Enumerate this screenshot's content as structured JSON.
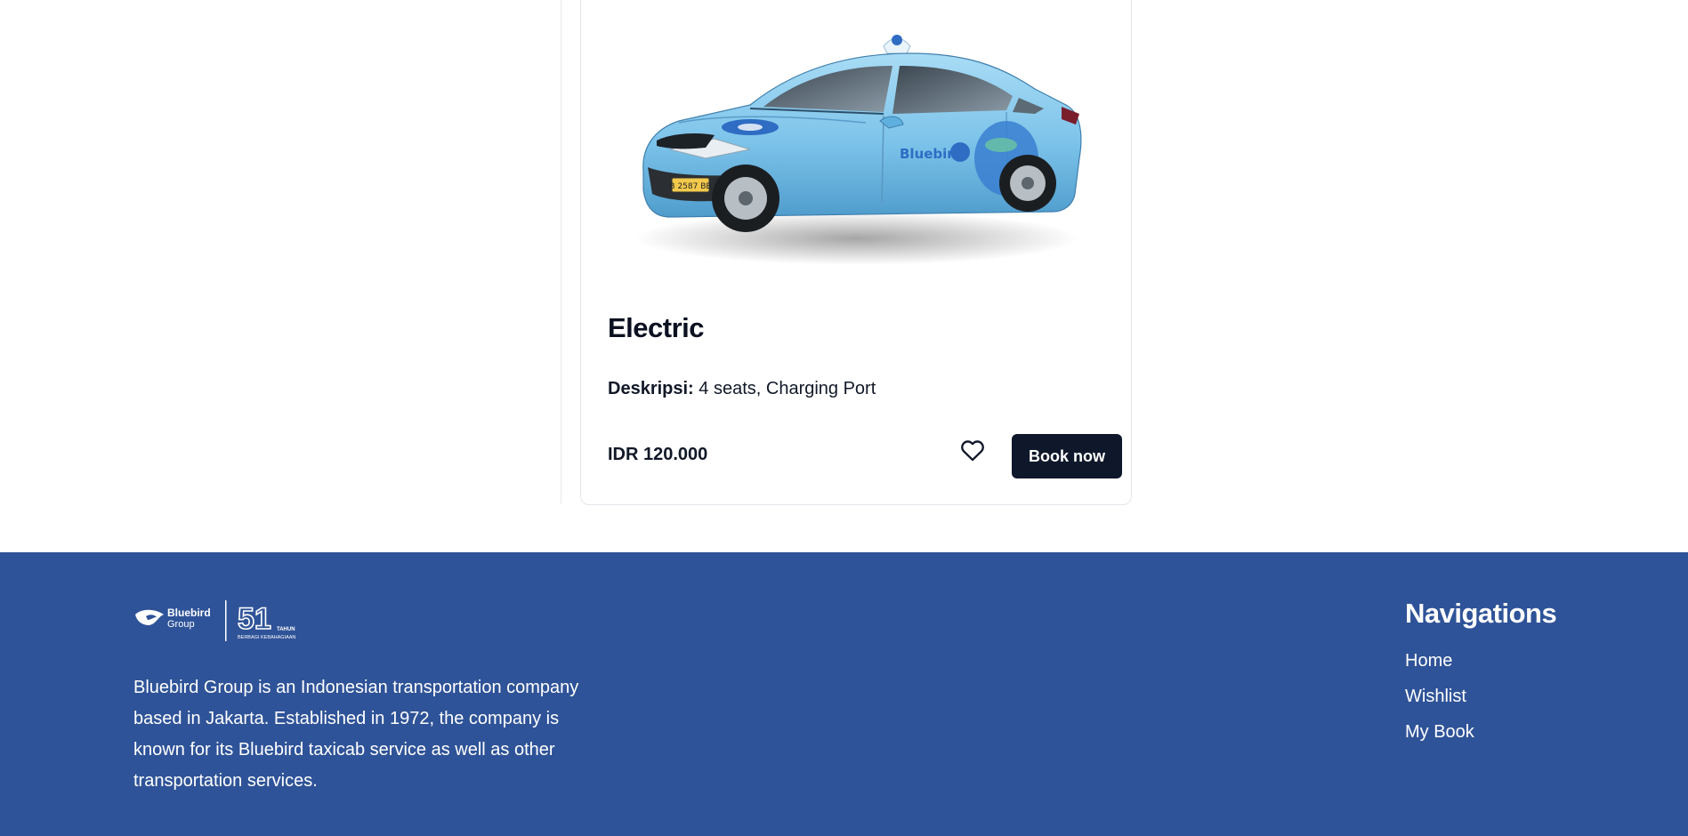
{
  "product": {
    "title": "Electric",
    "description_label": "Deskripsi:",
    "description_value": "4 seats, Charging Port",
    "price": "IDR 120.000",
    "book_label": "Book now",
    "plate": "B 2587 BB",
    "brand_on_car": "Bluebird"
  },
  "footer": {
    "logo_brand": "Bluebird",
    "logo_group": "Group",
    "logo_years": "51",
    "logo_years_word": "TAHUN",
    "logo_tagline": "BERBAGI KEBAHAGIAAN",
    "about": "Bluebird Group is an Indonesian transportation company based in Jakarta. Established in 1972, the company is known for its Bluebird taxicab service as well as other transportation services.",
    "nav_heading": "Navigations",
    "nav_items": [
      {
        "label": "Home"
      },
      {
        "label": "Wishlist"
      },
      {
        "label": "My Book"
      }
    ]
  },
  "colors": {
    "footer_bg": "#2f5398",
    "button_bg": "#0f172a",
    "car_body": "#7cc3ea"
  },
  "icons": {
    "wishlist": "heart-icon"
  }
}
